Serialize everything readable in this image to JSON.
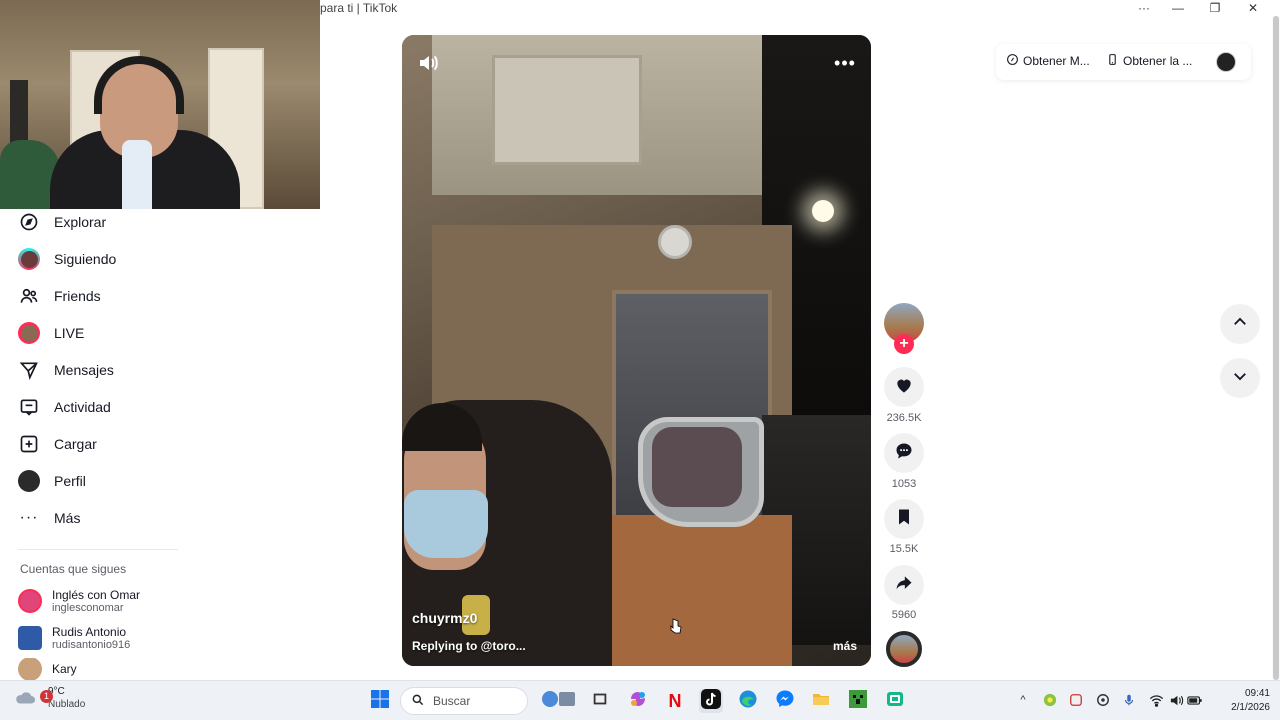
{
  "window": {
    "title": "para ti | TikTok",
    "controls": {
      "more": "···",
      "minimize": "—",
      "restore": "❐",
      "close": "✕"
    }
  },
  "sidebar": {
    "items": [
      {
        "label": "Explorar",
        "icon": "compass-icon"
      },
      {
        "label": "Siguiendo",
        "icon": "following-avatar-icon"
      },
      {
        "label": "Friends",
        "icon": "friends-icon"
      },
      {
        "label": "LIVE",
        "icon": "live-avatar-icon"
      },
      {
        "label": "Mensajes",
        "icon": "send-icon"
      },
      {
        "label": "Actividad",
        "icon": "activity-icon"
      },
      {
        "label": "Cargar",
        "icon": "upload-icon"
      },
      {
        "label": "Perfil",
        "icon": "profile-avatar-icon"
      },
      {
        "label": "Más",
        "icon": "more-icon"
      }
    ],
    "following_title": "Cuentas que sigues",
    "following": [
      {
        "name": "Inglés con Omar",
        "handle": "inglesconomar",
        "color": "#e0457b"
      },
      {
        "name": "Rudis Antonio",
        "handle": "rudisantonio916",
        "color": "#2e5aa8"
      },
      {
        "name": "Kary",
        "handle": "",
        "color": "#c8a07a"
      }
    ]
  },
  "video": {
    "username": "chuyrmz0",
    "caption": "Replying to @toro...",
    "more_label": "más",
    "more_menu": "•••"
  },
  "actions": {
    "follow_plus": "+",
    "likes": "236.5K",
    "comments": "1053",
    "saves": "15.5K",
    "shares": "5960"
  },
  "header": {
    "get_coins": "Obtener M...",
    "get_app": "Obtener la ..."
  },
  "taskbar": {
    "weather_temp": "9°C",
    "weather_desc": "Nublado",
    "weather_badge": "1",
    "search_placeholder": "Buscar",
    "time": "09:41",
    "date": "2/1/2026",
    "tray_chevron": "^"
  },
  "colors": {
    "accent": "#fe2c55",
    "teal": "#25f4ee",
    "text": "#161823",
    "muted": "#5c5c66"
  }
}
